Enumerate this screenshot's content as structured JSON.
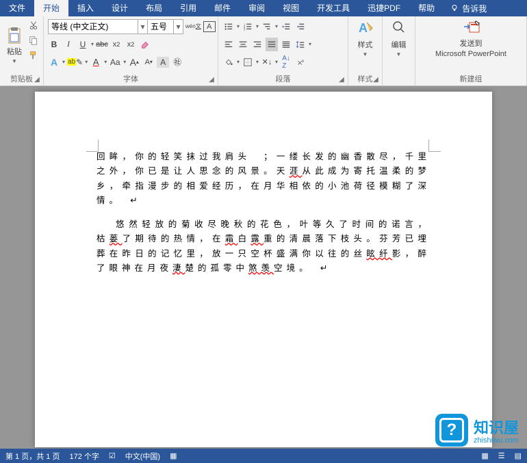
{
  "tabs": {
    "file": "文件",
    "home": "开始",
    "insert": "插入",
    "design": "设计",
    "layout": "布局",
    "references": "引用",
    "mailings": "邮件",
    "review": "审阅",
    "view": "视图",
    "devtools": "开发工具",
    "xunjie": "迅捷PDF",
    "help": "帮助",
    "tellme": "告诉我"
  },
  "ribbon": {
    "clipboard": {
      "label": "剪贴板",
      "paste": "粘贴"
    },
    "font": {
      "label": "字体",
      "name": "等线 (中文正文)",
      "size": "五号",
      "phonetic": "wén",
      "charborder": "A",
      "bold": "B",
      "italic": "I",
      "under": "U",
      "abc": "abc",
      "x2": "x₂",
      "X2": "x²",
      "Aa": "Aa",
      "grow": "A",
      "shrink": "A",
      "clearA": "A",
      "styleA": "A"
    },
    "para": {
      "label": "段落"
    },
    "styles": {
      "label": "样式",
      "btn": "样式"
    },
    "editing": {
      "label": "",
      "btn": "编辑"
    },
    "newgroup": {
      "label": "新建组",
      "line1": "发送到",
      "line2": "Microsoft PowerPoint"
    }
  },
  "doc": {
    "p1": "回眸，你的轻笑抹过我肩头　；一缕长发的幽香散尽，千里之外，你已是让人思念的风景。天<span class='err'>涯</span>从此成为寄托温柔的梦乡，牵指漫步的相爱经历，在月华相依的小池荷径模糊了深情。　↵",
    "p2": "悠然轻放的菊收尽晚秋的花色，叶等久了时间的诺言，枯<span class='err'>蒌</span>了期待的热情，在<span class='err'>霜</span>白<span class='err'>露</span>重的清晨落下枝头。芬芳已埋葬在昨日的记忆里，放一只空杯盛满你以往的丝<span class='err'>眩纤</span>影，醉了眼神在月夜<span class='err'>淒</span>楚的孤零中<span class='err'>煞羡</span>空境。　↵"
  },
  "status": {
    "page": "第 1 页，共 1 页",
    "words": "172 个字",
    "lang": "中文(中国)"
  },
  "watermark": {
    "title": "知识屋",
    "url": "zhishiwu.com",
    "badge": "?"
  }
}
